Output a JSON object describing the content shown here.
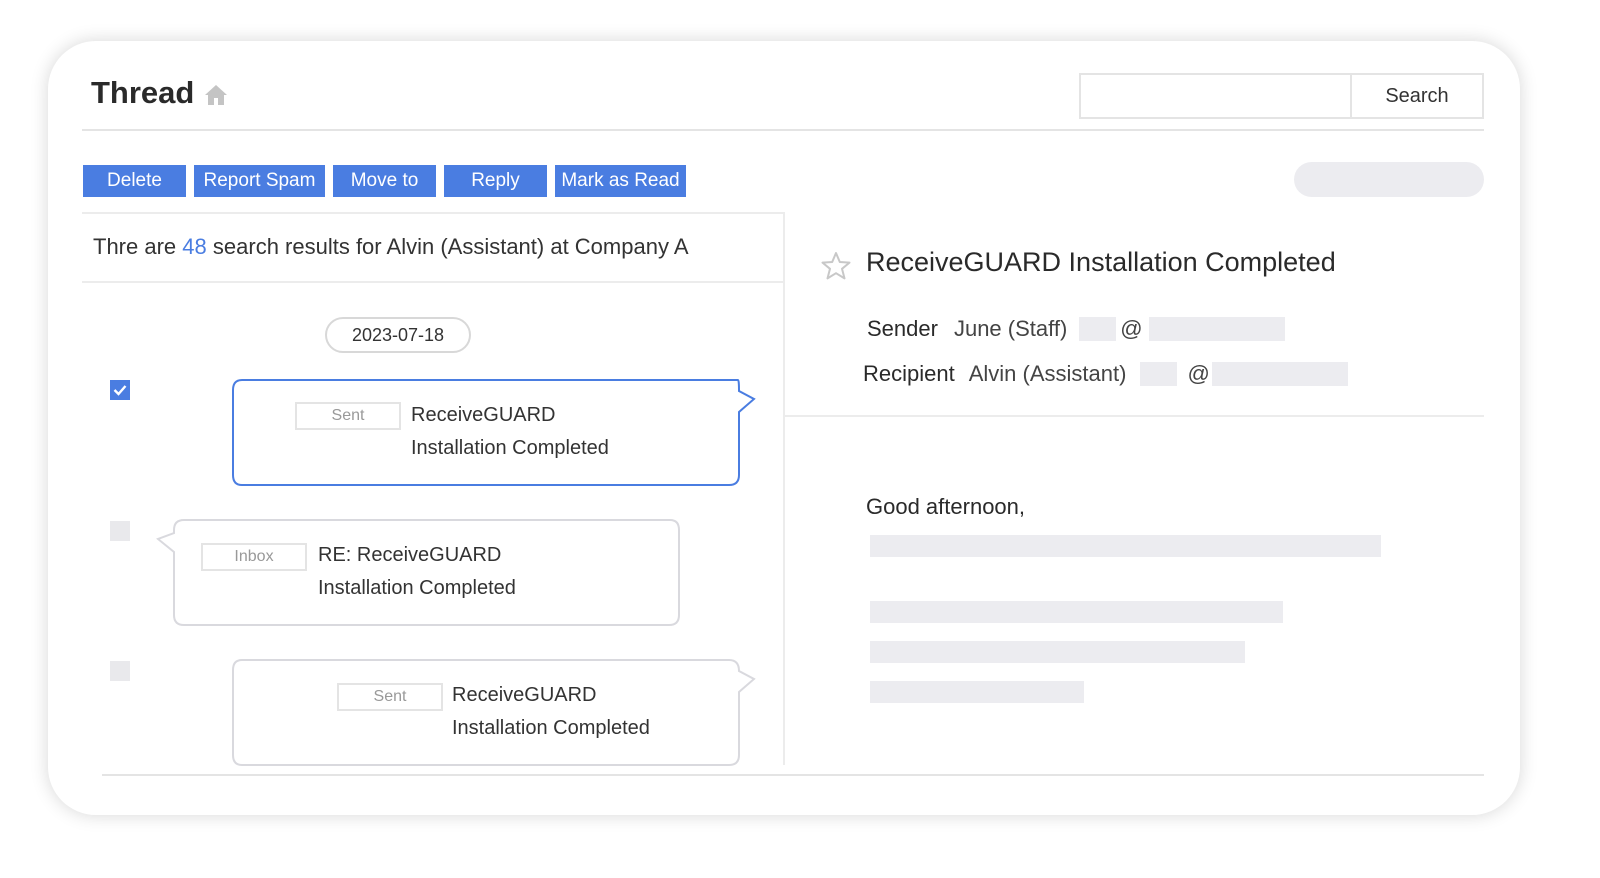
{
  "header": {
    "title": "Thread",
    "search_button": "Search",
    "search_value": ""
  },
  "toolbar": {
    "buttons": [
      "Delete",
      "Report Spam",
      "Move to",
      "Reply",
      "Mark as Read"
    ]
  },
  "results": {
    "prefix": "Thre are",
    "count": "48",
    "suffix": "search results for Alvin (Assistant) at Company A"
  },
  "thread": {
    "date": "2023-07-18",
    "messages": [
      {
        "tag": "Sent",
        "subject_line1": "ReceiveGUARD",
        "subject_line2": "Installation Completed",
        "checked": true,
        "selected": true
      },
      {
        "tag": "Inbox",
        "subject_line1": "RE: ReceiveGUARD",
        "subject_line2": "Installation Completed",
        "checked": false,
        "selected": false
      },
      {
        "tag": "Sent",
        "subject_line1": "ReceiveGUARD",
        "subject_line2": "Installation Completed",
        "checked": false,
        "selected": false
      }
    ]
  },
  "mail": {
    "subject": "ReceiveGUARD Installation Completed",
    "sender_label": "Sender",
    "sender_name": "June (Staff)",
    "recipient_label": "Recipient",
    "recipient_name": "Alvin (Assistant)",
    "at_symbol": "@",
    "greeting": "Good afternoon,"
  },
  "colors": {
    "accent": "#4a7de1",
    "placeholder": "#ececf0"
  },
  "icons": [
    "home-icon",
    "check-icon",
    "star-icon"
  ]
}
